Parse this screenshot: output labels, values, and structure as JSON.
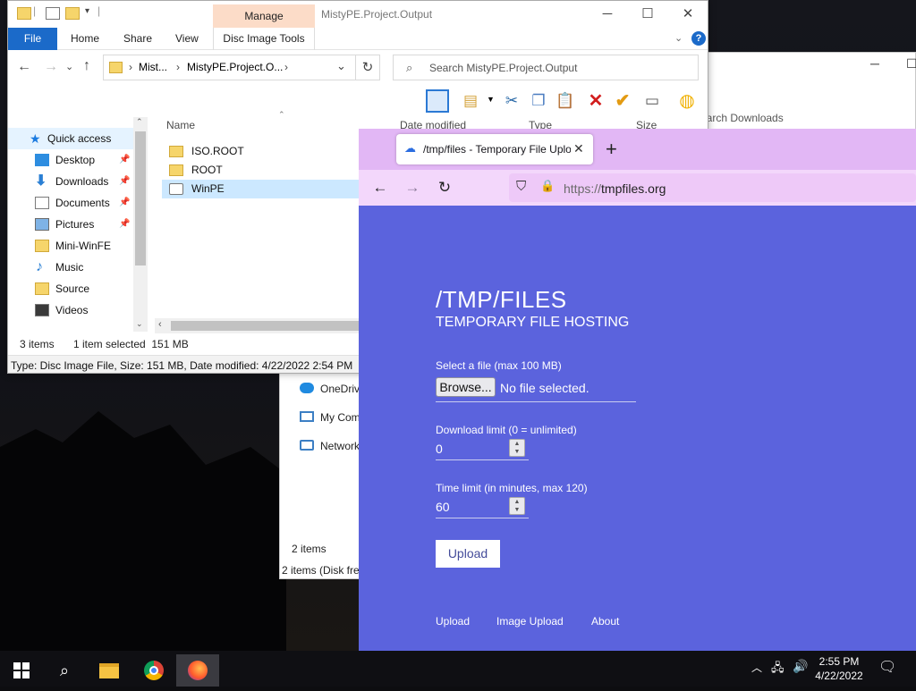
{
  "explorer": {
    "title": "MistyPE.Project.Output",
    "ribbon_tabs": [
      "File",
      "Home",
      "Share",
      "View"
    ],
    "manage_tab": "Manage",
    "disc_tab": "Disc Image Tools",
    "breadcrumb": [
      "Mist...",
      "MistyPE.Project.O..."
    ],
    "search_placeholder": "Search MistyPE.Project.Output",
    "nav_items": [
      {
        "label": "Quick access",
        "icon": "star-icon"
      },
      {
        "label": "Desktop",
        "icon": "desktop-icon",
        "pinned": true
      },
      {
        "label": "Downloads",
        "icon": "download-icon",
        "pinned": true
      },
      {
        "label": "Documents",
        "icon": "document-icon",
        "pinned": true
      },
      {
        "label": "Pictures",
        "icon": "pictures-icon",
        "pinned": true
      },
      {
        "label": "Mini-WinFE",
        "icon": "folder-icon"
      },
      {
        "label": "Music",
        "icon": "music-icon"
      },
      {
        "label": "Source",
        "icon": "folder-icon"
      },
      {
        "label": "Videos",
        "icon": "video-icon"
      }
    ],
    "columns": [
      "Name",
      "Date modified",
      "Type",
      "Size"
    ],
    "files": [
      {
        "name": "ISO.ROOT",
        "icon": "folder-icon"
      },
      {
        "name": "ROOT",
        "icon": "folder-icon"
      },
      {
        "name": "WinPE",
        "icon": "disc-image-icon",
        "selected": true
      }
    ],
    "status_count": "3 items",
    "status_selected": "1 item selected  151 MB",
    "details": "Type: Disc Image File, Size: 151 MB, Date modified: 4/22/2022 2:54 PM"
  },
  "bg_explorer": {
    "search_placeholder": "earch Downloads",
    "nav_items": [
      "OneDriv",
      "My Com",
      "Network"
    ],
    "status_count": "2 items",
    "details": "2 items (Disk free"
  },
  "firefox": {
    "tab_title": "/tmp/files - Temporary File Uplo",
    "url_scheme": "https://",
    "url_host": "tmpfiles.org",
    "page": {
      "title": "/TMP/FILES",
      "subtitle": "TEMPORARY FILE HOSTING",
      "file_label": "Select a file (max 100 MB)",
      "browse": "Browse...",
      "no_file": "No file selected.",
      "download_label": "Download limit (0 = unlimited)",
      "download_value": "0",
      "time_label": "Time limit (in minutes, max 120)",
      "time_value": "60",
      "upload_button": "Upload",
      "footer_links": [
        "Upload",
        "Image Upload",
        "About"
      ]
    }
  },
  "taskbar": {
    "time": "2:55 PM",
    "date": "4/22/2022"
  },
  "colors": {
    "page_bg": "#5b63dd",
    "tabstrip": "#e2b7f5",
    "file_tab": "#1b6ac9",
    "manage_tab": "#fcdcc8",
    "selection": "#cce8ff"
  }
}
